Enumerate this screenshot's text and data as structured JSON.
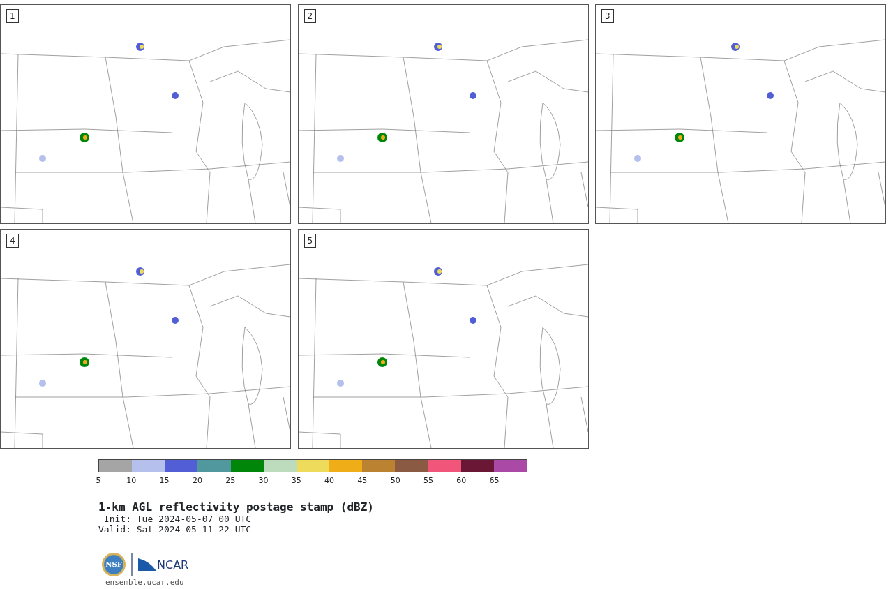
{
  "panels": [
    {
      "number": "1"
    },
    {
      "number": "2"
    },
    {
      "number": "3"
    },
    {
      "number": "4"
    },
    {
      "number": "5"
    }
  ],
  "colorbar": {
    "segments": [
      {
        "color": "#a5a5a5"
      },
      {
        "color": "#b5c1ec"
      },
      {
        "color": "#525ed6"
      },
      {
        "color": "#50979e"
      },
      {
        "color": "#00870a"
      },
      {
        "color": "#bddcbd"
      },
      {
        "color": "#efdb5b"
      },
      {
        "color": "#efae18"
      },
      {
        "color": "#ba8231"
      },
      {
        "color": "#8a5a42"
      },
      {
        "color": "#f2557a"
      },
      {
        "color": "#691735"
      },
      {
        "color": "#ab4aa6"
      }
    ],
    "tick_labels": [
      "5",
      "10",
      "15",
      "20",
      "25",
      "30",
      "35",
      "40",
      "45",
      "50",
      "55",
      "60",
      "65"
    ]
  },
  "title": "1-km AGL reflectivity postage stamp (dBZ)",
  "init": " Init: Tue 2024-05-07 00 UTC",
  "valid": "Valid: Sat 2024-05-11 22 UTC",
  "logo": {
    "nsf_text": "NSF",
    "ncar_text": "NCAR"
  },
  "footer_url": "ensemble.ucar.edu"
}
